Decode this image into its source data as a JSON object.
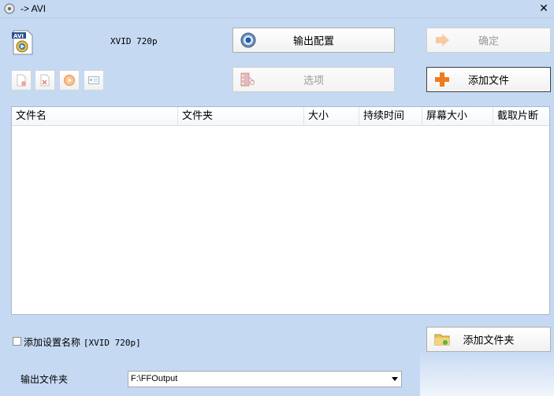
{
  "window": {
    "title": "-> AVI"
  },
  "profile": {
    "label": "XVID 720p"
  },
  "buttons": {
    "output_config": "输出配置",
    "confirm": "确定",
    "options": "选项",
    "add_file": "添加文件",
    "add_folder": "添加文件夹"
  },
  "table": {
    "columns": [
      "文件名",
      "文件夹",
      "大小",
      "持续时间",
      "屏幕大小",
      "截取片断"
    ]
  },
  "footer": {
    "add_setting_label": "添加设置名称",
    "add_setting_value": "[XVID 720p]",
    "output_folder_label": "输出文件夹",
    "output_folder_value": "F:\\FFOutput"
  },
  "colors": {
    "background": "#c5d9f2",
    "accent_orange": "#f07a1a",
    "disabled_text": "#9a9a9a"
  }
}
